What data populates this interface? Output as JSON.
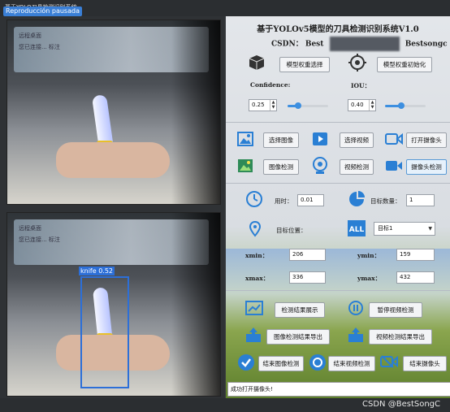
{
  "window": {
    "title": "基于YOLO刀具检测识别系统",
    "overlay_tag": "Reproducción pausada"
  },
  "left_views": {
    "video_text_line1": "远程桌面",
    "video_text_line2": "您已连接...   标注",
    "detection_label": "knife 0.52"
  },
  "header": {
    "title": "基于YOLOv5模型的刀具检测识别系统V1.0",
    "csdn_label": "CSDN：",
    "csdn_partial": "Best",
    "csdn_name": "Bestsongc"
  },
  "model": {
    "select_button": "模型权重选择",
    "init_button": "模型权重初始化"
  },
  "params": {
    "confidence_label": "Confidence:",
    "confidence_value": "0.25",
    "confidence_level": 0.25,
    "iou_label": "IOU：",
    "iou_value": "0.40",
    "iou_level": 0.4
  },
  "sources": {
    "select_image": "选择图像",
    "select_video": "选择视频",
    "open_camera": "打开摄像头",
    "image_detect": "图像检测",
    "video_detect": "视频检测",
    "camera_detect": "摄像头检测"
  },
  "stats": {
    "time_label": "用时：",
    "time_value": "0.01",
    "count_label": "目标数量：",
    "count_value": "1",
    "position_label": "目标位置：",
    "target_select": "目标1",
    "xmin_label": "xmin：",
    "xmin_value": "206",
    "ymin_label": "ymin：",
    "ymin_value": "159",
    "xmax_label": "xmax：",
    "xmax_value": "336",
    "ymax_label": "ymax：",
    "ymax_value": "432"
  },
  "actions": {
    "show_result": "检测结果展示",
    "pause_video": "暂停视频检测",
    "export_image": "图像检测结果导出",
    "export_video": "视频检测结果导出",
    "end_image": "结束图像检测",
    "end_video": "结束视频检测",
    "end_camera": "结束摄像头"
  },
  "status_text": "成功打开摄像头!",
  "watermark": "CSDN @BestSongC",
  "colors": {
    "accent": "#3d8fe0",
    "bbox": "#2c6fd8",
    "handle": "#e8c02a"
  }
}
